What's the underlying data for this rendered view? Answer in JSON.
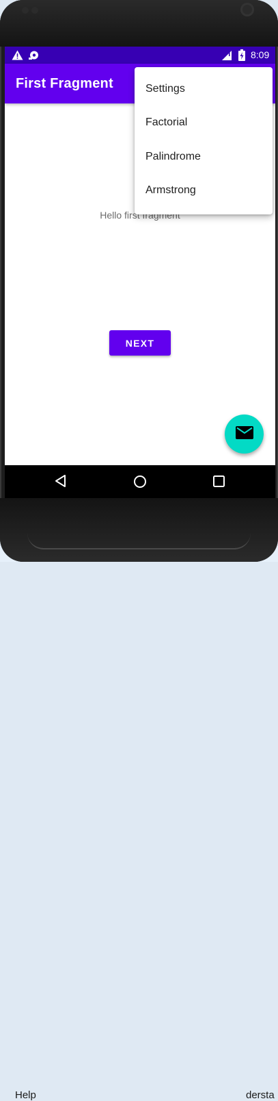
{
  "background": {
    "left_text": "Help",
    "right_text": "dersta"
  },
  "statusbar": {
    "time": "8:09",
    "icons": [
      "warning-icon",
      "sync-icon",
      "signal-icon",
      "battery-charging-icon"
    ]
  },
  "appbar": {
    "title": "First Fragment",
    "color": "#6200ee"
  },
  "overflow_menu": {
    "items": [
      {
        "label": "Settings"
      },
      {
        "label": "Factorial"
      },
      {
        "label": "Palindrome"
      },
      {
        "label": "Armstrong"
      }
    ]
  },
  "content": {
    "hello_text": "Hello first fragment",
    "next_button_label": "NEXT"
  },
  "fab": {
    "icon": "email-icon",
    "color": "#03dac5"
  },
  "navbar": {
    "icons": [
      "back-icon",
      "home-icon",
      "recents-icon"
    ]
  },
  "colors": {
    "statusbar": "#3700b3",
    "primary": "#6200ee",
    "accent": "#03dac5"
  }
}
